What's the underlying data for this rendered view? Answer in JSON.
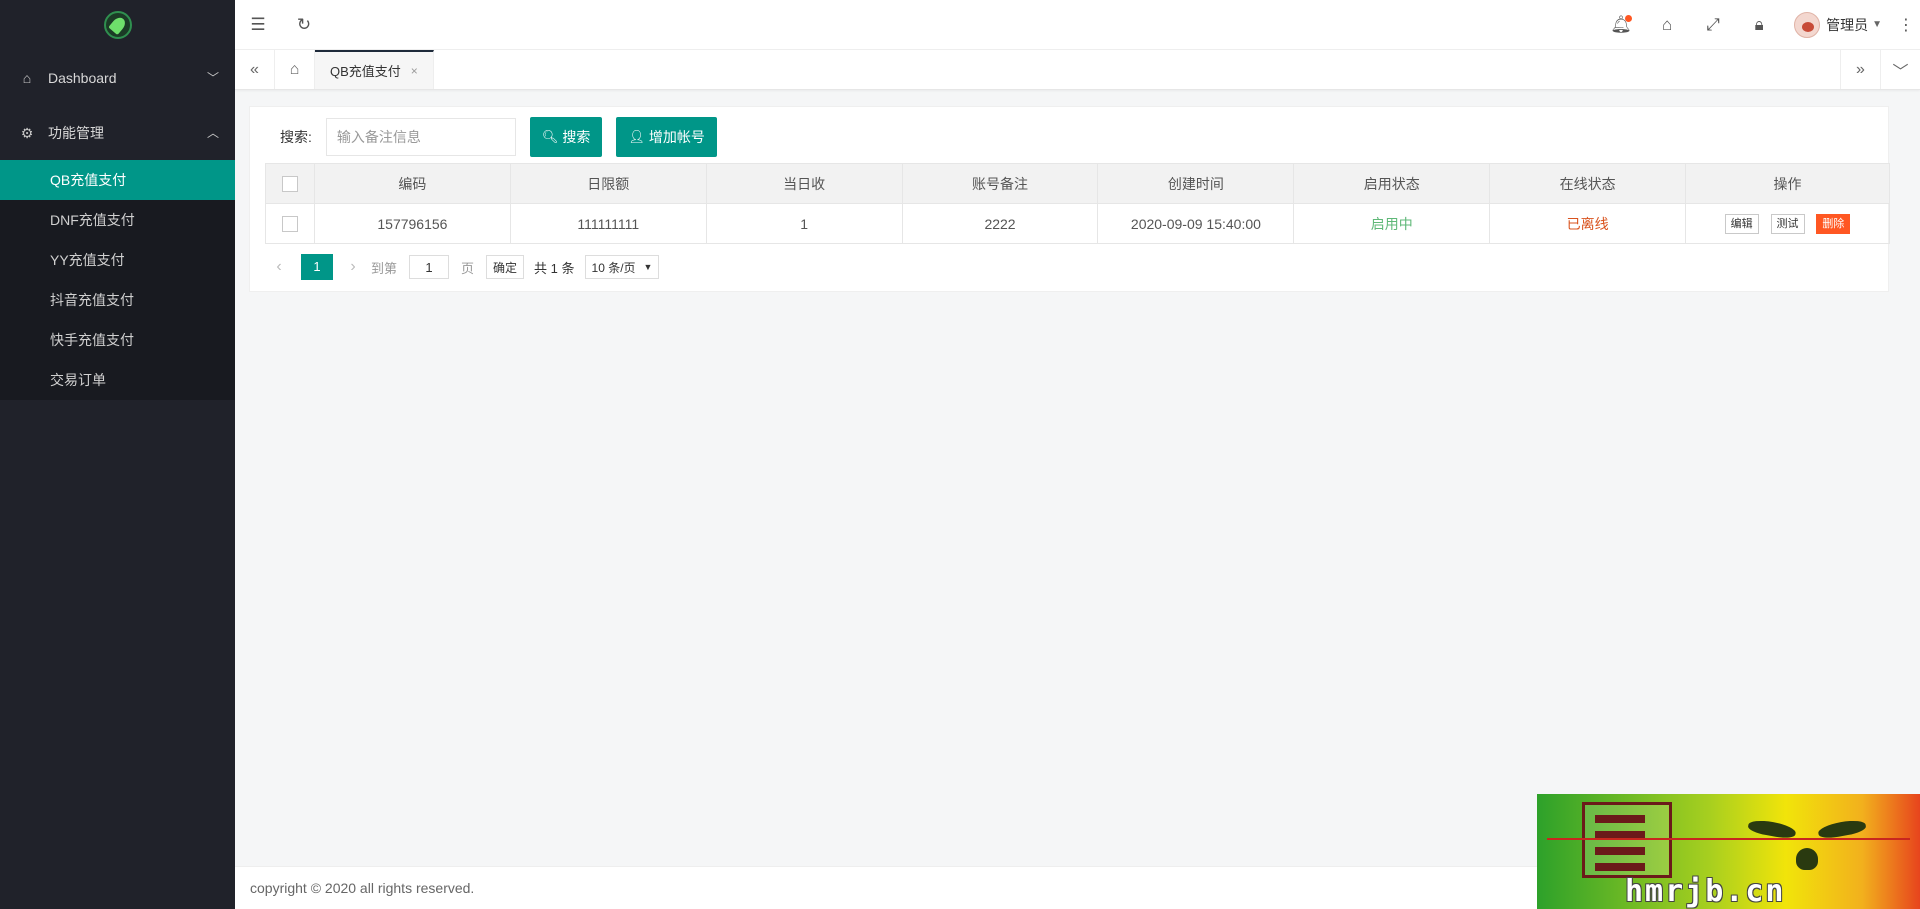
{
  "sidebar": {
    "groups": [
      {
        "label": "Dashboard",
        "icon": "home-icon",
        "expanded": false
      },
      {
        "label": "功能管理",
        "icon": "gear-icon",
        "expanded": true
      }
    ],
    "items": [
      {
        "label": "QB充值支付",
        "active": true
      },
      {
        "label": "DNF充值支付",
        "active": false
      },
      {
        "label": "YY充值支付",
        "active": false
      },
      {
        "label": "抖音充值支付",
        "active": false
      },
      {
        "label": "快手充值支付",
        "active": false
      },
      {
        "label": "交易订单",
        "active": false
      }
    ]
  },
  "header": {
    "user_name": "管理员",
    "notification_dot_color": "#ff5722"
  },
  "tabs": {
    "active_tab": {
      "label": "QB充值支付",
      "close": "×"
    }
  },
  "search": {
    "label": "搜索:",
    "placeholder": "输入备注信息",
    "search_button": "搜索",
    "add_button": "增加帐号"
  },
  "table": {
    "columns": [
      "编码",
      "日限额",
      "当日收",
      "账号备注",
      "创建时间",
      "启用状态",
      "在线状态",
      "操作"
    ],
    "rows": [
      {
        "code": "157796156",
        "daily_limit": "111111111",
        "today_received": "1",
        "remark": "2222",
        "created_at": "2020-09-09 15:40:00",
        "enabled_status": "启用中",
        "online_status": "已离线",
        "actions": [
          "编辑",
          "测试",
          "删除"
        ]
      }
    ]
  },
  "pagination": {
    "current_page": "1",
    "goto_label": "到第",
    "goto_value": "1",
    "page_unit": "页",
    "confirm": "确定",
    "total": "共 1 条",
    "page_size": "10 条/页"
  },
  "footer": {
    "copyright": "copyright © 2020 all rights reserved."
  },
  "watermark": {
    "text": "hmrjb.cn"
  },
  "colors": {
    "accent": "#009688",
    "sidebar_bg": "#20222a",
    "danger": "#ff5722",
    "enabled": "#5fb878",
    "offline": "#d9531e"
  }
}
